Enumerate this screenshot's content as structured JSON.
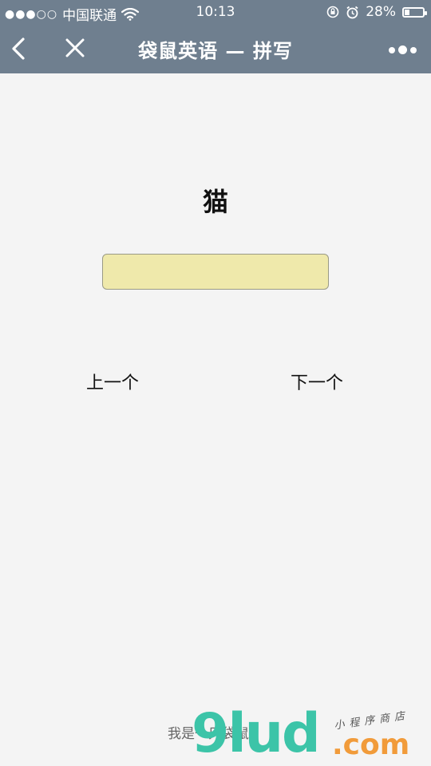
{
  "status_bar": {
    "signal": "●●●○○",
    "carrier": "中国联通",
    "time": "10:13",
    "battery_text": "28%",
    "battery_level": 0.28
  },
  "navbar": {
    "title": "袋鼠英语 — 拼写",
    "back_icon": "chevron-left-icon",
    "close_icon": "close-icon",
    "more_icon": "more-dots-icon"
  },
  "main": {
    "word": "猫",
    "answer_value": "",
    "answer_placeholder": "",
    "prev_label": "上一个",
    "next_label": "下一个"
  },
  "footer": {
    "text": "我是一只袋鼠"
  },
  "watermark": {
    "main": "9lud",
    "domain": ".com",
    "tagline": "小程序商店"
  },
  "colors": {
    "header_bg": "#6f7f8f",
    "page_bg": "#f4f4f4",
    "input_bg": "#efe9ab",
    "watermark_green": "#3cc4a8",
    "watermark_orange": "#f19b3a"
  }
}
